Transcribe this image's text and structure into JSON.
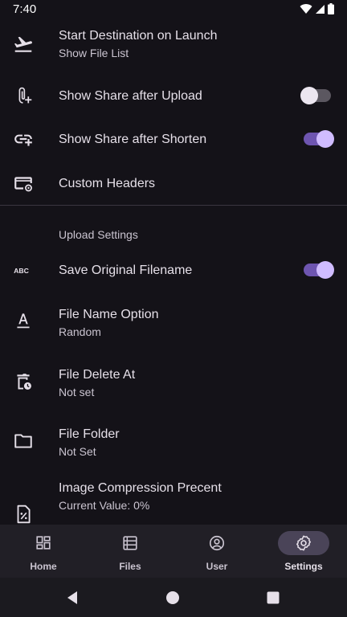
{
  "status_bar": {
    "time": "7:40"
  },
  "settings": {
    "items_top": [
      {
        "title": "Start Destination on Launch",
        "subtitle": "Show File List",
        "icon": "flight-takeoff-icon"
      },
      {
        "title": "Show Share after Upload",
        "icon": "attach-add-icon",
        "toggle": false
      },
      {
        "title": "Show Share after Shorten",
        "icon": "link-add-icon",
        "toggle": true
      },
      {
        "title": "Custom Headers",
        "icon": "card-settings-icon"
      }
    ],
    "upload_section": {
      "header": "Upload Settings",
      "items": [
        {
          "title": "Save Original Filename",
          "icon": "abc-icon",
          "toggle": true
        },
        {
          "title": "File Name Option",
          "subtitle": "Random",
          "icon": "text-format-icon"
        },
        {
          "title": "File Delete At",
          "subtitle": "Not set",
          "icon": "delete-clock-icon"
        },
        {
          "title": "File Folder",
          "subtitle": "Not Set",
          "icon": "folder-icon"
        },
        {
          "title": "Image Compression Precent",
          "subtitle": "Current Value: 0%",
          "icon": "file-percent-icon"
        }
      ]
    }
  },
  "bottom_nav": {
    "items": [
      {
        "label": "Home",
        "icon": "dashboard-icon"
      },
      {
        "label": "Files",
        "icon": "list-icon"
      },
      {
        "label": "User",
        "icon": "account-icon"
      },
      {
        "label": "Settings",
        "icon": "gear-icon",
        "active": true
      }
    ]
  },
  "colors": {
    "background": "#141218",
    "accent": "#d0bcff",
    "switch_track_on": "#6e55b0",
    "nav_background": "#211f26"
  }
}
